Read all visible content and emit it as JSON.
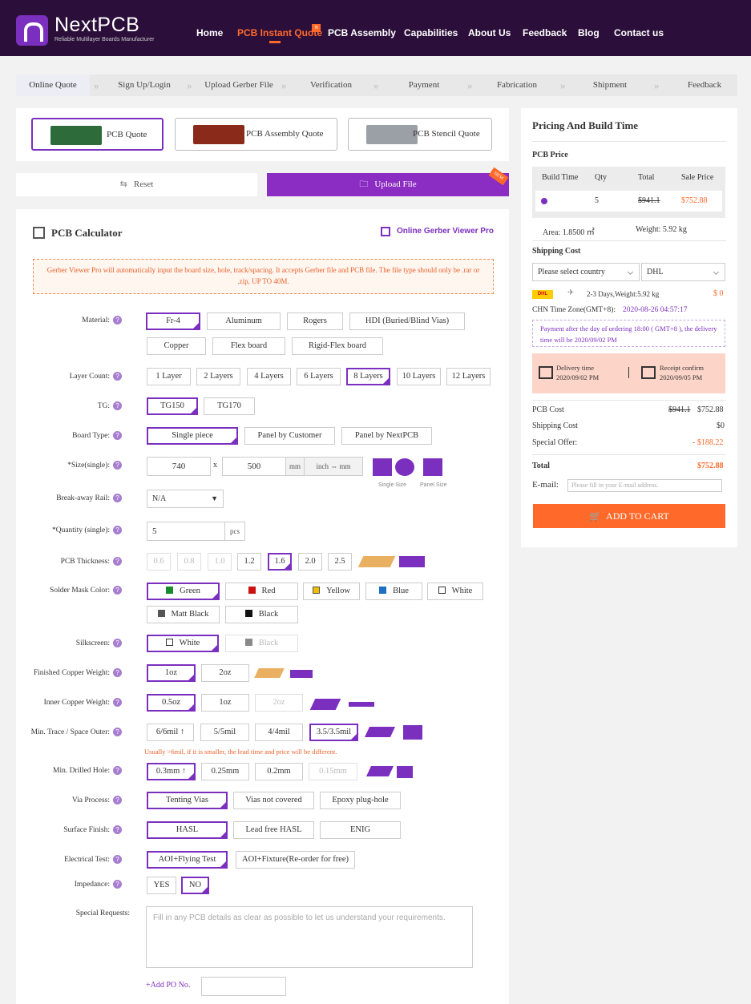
{
  "nav": {
    "logo_name": "NextPCB",
    "logo_sub": "Reliable Multilayer Boards Manufacturer",
    "items": [
      "Home",
      "PCB Instant Quote",
      "PCB Assembly",
      "Capabilities",
      "About Us",
      "Feedback",
      "Blog",
      "Contact us"
    ],
    "new_badge": "N"
  },
  "steps": [
    "Online Quote",
    "Sign Up/Login",
    "Upload Gerber File",
    "Verification",
    "Payment",
    "Fabrication",
    "Shipment",
    "Feedback"
  ],
  "quote_types": [
    "PCB Quote",
    "PCB Assembly Quote",
    "PCB Stencil Quote"
  ],
  "actions": {
    "reset": "Reset",
    "upload": "Upload File",
    "new": "NEW"
  },
  "calc": {
    "title": "PCB Calculator",
    "viewer_link": "Online Gerber Viewer Pro",
    "notice": "Gerber Viewer Pro will automatically input the board size, hole, track/spacing. It accepts Gerber file and PCB file. The file type should only be .rar or .zip, UP TO 40M."
  },
  "labels": {
    "material": "Material:",
    "layer": "Layer Count:",
    "tg": "TG:",
    "board_type": "Board Type:",
    "size": "*Size(single):",
    "rail": "Break-away Rail:",
    "qty": "*Quantity (single):",
    "thickness": "PCB Thickness:",
    "solder": "Solder Mask Color:",
    "silk": "Silkscreen:",
    "fcopper": "Finished Copper Weight:",
    "icopper": "Inner Copper Weight:",
    "trace": "Min. Trace / Space Outer:",
    "hole": "Min. Drilled Hole:",
    "via": "Via Process:",
    "surface": "Surface Finish:",
    "etest": "Electrical Test:",
    "impedance": "Impedance:",
    "special": "Special Requests:"
  },
  "options": {
    "material": [
      "Fr-4",
      "Aluminum",
      "Rogers",
      "HDI (Buried/Blind Vias)",
      "Copper",
      "Flex board",
      "Rigid-Flex board"
    ],
    "layer": [
      "1 Layer",
      "2 Layers",
      "4 Layers",
      "6 Layers",
      "8 Layers",
      "10 Layers",
      "12 Layers"
    ],
    "tg": [
      "TG150",
      "TG170"
    ],
    "board_type": [
      "Single piece",
      "Panel by Customer",
      "Panel by NextPCB"
    ],
    "thickness": [
      "0.6",
      "0.8",
      "1.0",
      "1.2",
      "1.6",
      "2.0",
      "2.5"
    ],
    "solder": [
      "Green",
      "Red",
      "Yellow",
      "Blue",
      "White",
      "Matt Black",
      "Black"
    ],
    "silk": [
      "White",
      "Black"
    ],
    "fcopper": [
      "1oz",
      "2oz"
    ],
    "icopper": [
      "0.5oz",
      "1oz",
      "2oz"
    ],
    "trace": [
      "6/6mil ↑",
      "5/5mil",
      "4/4mil",
      "3.5/3.5mil"
    ],
    "hole": [
      "0.3mm ↑",
      "0.25mm",
      "0.2mm",
      "0.15mm"
    ],
    "via": [
      "Tenting Vias",
      "Vias not covered",
      "Epoxy plug-hole"
    ],
    "surface": [
      "HASL",
      "Lead free HASL",
      "ENIG"
    ],
    "etest": [
      "AOI+Flying Test",
      "AOI+Fixture(Re-order for free)"
    ],
    "impedance": [
      "YES",
      "NO"
    ]
  },
  "colors": {
    "Green": "#1a8a2e",
    "Red": "#cc1111",
    "Yellow": "#f0c000",
    "Blue": "#1f6fc0",
    "White": "#ffffff",
    "Matt Black": "#555555",
    "Black": "#111111",
    "Silk White": "#ffffff",
    "Silk Black": "#888888"
  },
  "size": {
    "width": "740",
    "x": "x",
    "height": "500",
    "unit": "mm",
    "convert": "inch ⇔ mm",
    "single_lbl": "Single Size",
    "panel_lbl": "Panel Size"
  },
  "rail": "N/A",
  "qty": {
    "value": "5",
    "unit": "pcs"
  },
  "trace_warn": "Usually >6mil, if it is smaller, the lead time and price will be different.",
  "special_placeholder": "Fill in any PCB details as clear as possible to let us understand your requirements.",
  "po": "+Add PO No.",
  "side": {
    "title": "Pricing And Build Time",
    "pcb_price": "PCB Price",
    "table_head": [
      "Build Time",
      "Qty",
      "Total",
      "Sale Price"
    ],
    "row": {
      "qty": "5",
      "total": "$941.1",
      "sale": "$752.88"
    },
    "area": "Area: 1.8500 ㎡",
    "weight": "Weight: 5.92 kg",
    "shipping": "Shipping Cost",
    "country": "Please select country",
    "carrier": "DHL",
    "ship_info": "2-3 Days,Weight:5.92 kg",
    "ship_cost": "$ 0",
    "timezone": "CHN Time Zone(GMT+8):",
    "tz_time": "2020-08-26 04:57:17",
    "pay_note": "Payment after the day of ordering 18:00 ( GMT+8 ), the delivery time will be 2020/09/02 PM",
    "delivery_lbl": "Delivery time",
    "delivery_date": "2020/09/02 PM",
    "receipt_lbl": "Receipt confirm",
    "receipt_date": "2020/09/05 PM",
    "pcb_cost": "PCB Cost",
    "pcb_cost_old": "$941.1",
    "pcb_cost_new": "$752.88",
    "ship_cost_lbl": "Shipping Cost",
    "ship_cost_val": "$0",
    "offer": "Special Offer:",
    "offer_val": "- $188.22",
    "total": "Total",
    "total_val": "$752.88",
    "email": "E-mail:",
    "email_ph": "Please fill in your E-mail address.",
    "cart": "ADD TO CART"
  }
}
